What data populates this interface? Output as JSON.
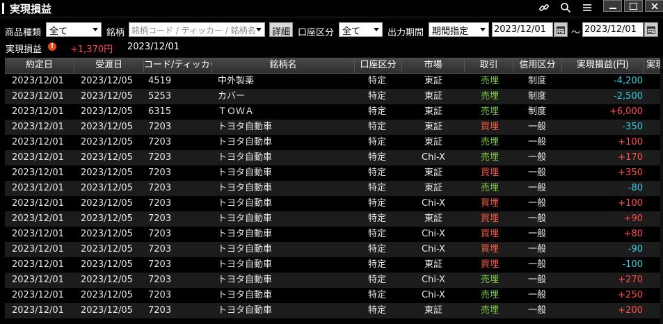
{
  "window": {
    "title": "実現損益"
  },
  "filters": {
    "product_label": "商品種類",
    "product_value": "全て",
    "stock_label": "銘柄",
    "stock_placeholder": "銘柄コード / ティッカー / 銘柄名",
    "detail_button": "詳細",
    "account_label": "口座区分",
    "account_value": "全て",
    "period_label": "出力期間",
    "period_value": "期間指定",
    "date_from": "2023/12/01",
    "tilde": "～",
    "date_to": "2023/12/01"
  },
  "summary": {
    "label": "実現損益",
    "warn_icon": "!",
    "value": "+1,370円",
    "date": "2023/12/01"
  },
  "table": {
    "headers": [
      "約定日",
      "受渡日",
      "コード/ティッカー",
      "銘柄名",
      "口座区分",
      "市場",
      "取引",
      "信用区分",
      "実現損益(円)",
      "実現"
    ],
    "rows": [
      {
        "yaku": "2023/12/01",
        "uke": "2023/12/05",
        "code": "4519",
        "name": "中外製薬",
        "acct": "特定",
        "mkt": "東証",
        "trd": "売埋",
        "cred": "制度",
        "pl": "-4,200"
      },
      {
        "yaku": "2023/12/01",
        "uke": "2023/12/05",
        "code": "5253",
        "name": "カバー",
        "acct": "特定",
        "mkt": "東証",
        "trd": "売埋",
        "cred": "制度",
        "pl": "-2,500"
      },
      {
        "yaku": "2023/12/01",
        "uke": "2023/12/05",
        "code": "6315",
        "name": "ＴＯＷＡ",
        "acct": "特定",
        "mkt": "東証",
        "trd": "売埋",
        "cred": "制度",
        "pl": "+6,000"
      },
      {
        "yaku": "2023/12/01",
        "uke": "2023/12/05",
        "code": "7203",
        "name": "トヨタ自動車",
        "acct": "特定",
        "mkt": "東証",
        "trd": "買埋",
        "cred": "一般",
        "pl": "-350"
      },
      {
        "yaku": "2023/12/01",
        "uke": "2023/12/05",
        "code": "7203",
        "name": "トヨタ自動車",
        "acct": "特定",
        "mkt": "東証",
        "trd": "売埋",
        "cred": "一般",
        "pl": "+100"
      },
      {
        "yaku": "2023/12/01",
        "uke": "2023/12/05",
        "code": "7203",
        "name": "トヨタ自動車",
        "acct": "特定",
        "mkt": "Chi-X",
        "trd": "売埋",
        "cred": "一般",
        "pl": "+170"
      },
      {
        "yaku": "2023/12/01",
        "uke": "2023/12/05",
        "code": "7203",
        "name": "トヨタ自動車",
        "acct": "特定",
        "mkt": "東証",
        "trd": "買埋",
        "cred": "一般",
        "pl": "+350"
      },
      {
        "yaku": "2023/12/01",
        "uke": "2023/12/05",
        "code": "7203",
        "name": "トヨタ自動車",
        "acct": "特定",
        "mkt": "東証",
        "trd": "売埋",
        "cred": "一般",
        "pl": "-80"
      },
      {
        "yaku": "2023/12/01",
        "uke": "2023/12/05",
        "code": "7203",
        "name": "トヨタ自動車",
        "acct": "特定",
        "mkt": "Chi-X",
        "trd": "買埋",
        "cred": "一般",
        "pl": "+100"
      },
      {
        "yaku": "2023/12/01",
        "uke": "2023/12/05",
        "code": "7203",
        "name": "トヨタ自動車",
        "acct": "特定",
        "mkt": "東証",
        "trd": "買埋",
        "cred": "一般",
        "pl": "+90"
      },
      {
        "yaku": "2023/12/01",
        "uke": "2023/12/05",
        "code": "7203",
        "name": "トヨタ自動車",
        "acct": "特定",
        "mkt": "Chi-X",
        "trd": "買埋",
        "cred": "一般",
        "pl": "+80"
      },
      {
        "yaku": "2023/12/01",
        "uke": "2023/12/05",
        "code": "7203",
        "name": "トヨタ自動車",
        "acct": "特定",
        "mkt": "Chi-X",
        "trd": "買埋",
        "cred": "一般",
        "pl": "-90"
      },
      {
        "yaku": "2023/12/01",
        "uke": "2023/12/05",
        "code": "7203",
        "name": "トヨタ自動車",
        "acct": "特定",
        "mkt": "東証",
        "trd": "買埋",
        "cred": "一般",
        "pl": "-100"
      },
      {
        "yaku": "2023/12/01",
        "uke": "2023/12/05",
        "code": "7203",
        "name": "トヨタ自動車",
        "acct": "特定",
        "mkt": "Chi-X",
        "trd": "売埋",
        "cred": "一般",
        "pl": "+270"
      },
      {
        "yaku": "2023/12/01",
        "uke": "2023/12/05",
        "code": "7203",
        "name": "トヨタ自動車",
        "acct": "特定",
        "mkt": "Chi-X",
        "trd": "売埋",
        "cred": "一般",
        "pl": "+250"
      },
      {
        "yaku": "2023/12/01",
        "uke": "2023/12/05",
        "code": "7203",
        "name": "トヨタ自動車",
        "acct": "特定",
        "mkt": "東証",
        "trd": "売埋",
        "cred": "一般",
        "pl": "+200"
      }
    ]
  },
  "colors": {
    "sell": "#7ccf3a",
    "buy": "#ff5a3a",
    "positive": "#ff4d4d",
    "negative": "#2fd0e0"
  },
  "icons": [
    "link-icon",
    "search-icon",
    "menu-icon",
    "minimize-icon",
    "maximize-icon",
    "close-icon",
    "calendar-icon",
    "warning-icon"
  ]
}
